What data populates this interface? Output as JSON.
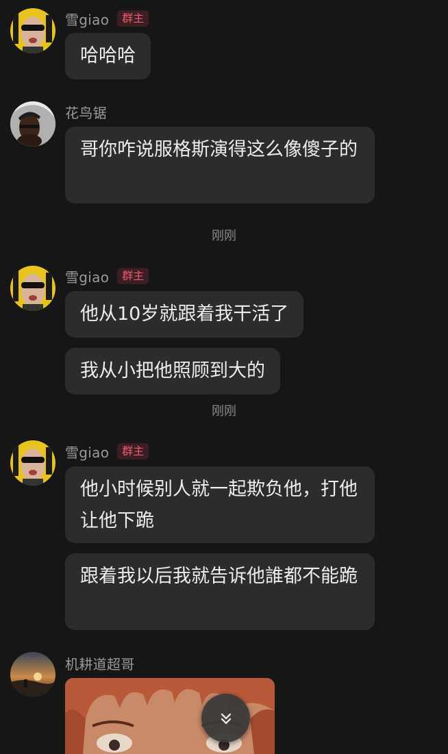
{
  "messages": [
    {
      "sender": "雪giao",
      "badge": "群主",
      "avatar_icon": "xuegiao-avatar-icon",
      "bubbles": [
        "哈哈哈"
      ]
    },
    {
      "sender": "花鸟锯",
      "avatar_icon": "huaniaoju-avatar-icon",
      "bubbles": [
        "哥你咋说服格斯演得这么像傻子的"
      ]
    },
    {
      "timestamp": "刚刚"
    },
    {
      "sender": "雪giao",
      "badge": "群主",
      "avatar_icon": "xuegiao-avatar-icon",
      "bubbles": [
        "他从10岁就跟着我干活了",
        "我从小把他照顾到大的"
      ]
    },
    {
      "timestamp": "刚刚"
    },
    {
      "sender": "雪giao",
      "badge": "群主",
      "avatar_icon": "xuegiao-avatar-icon",
      "bubbles": [
        "他小时候别人就一起欺负他，打他让他下跪",
        "跟着我以后我就告诉他誰都不能跪"
      ]
    },
    {
      "sender": "机耕道超哥",
      "avatar_icon": "sunset-avatar-icon",
      "image": "anime-character-image"
    }
  ],
  "scroll_button": {
    "icon": "double-chevron-down-icon"
  },
  "colors": {
    "background": "#161616",
    "bubble": "#2c2c2c",
    "badge_text": "#f05a6c",
    "badge_bg": "#3b1e24",
    "name": "#9a9a9a"
  }
}
